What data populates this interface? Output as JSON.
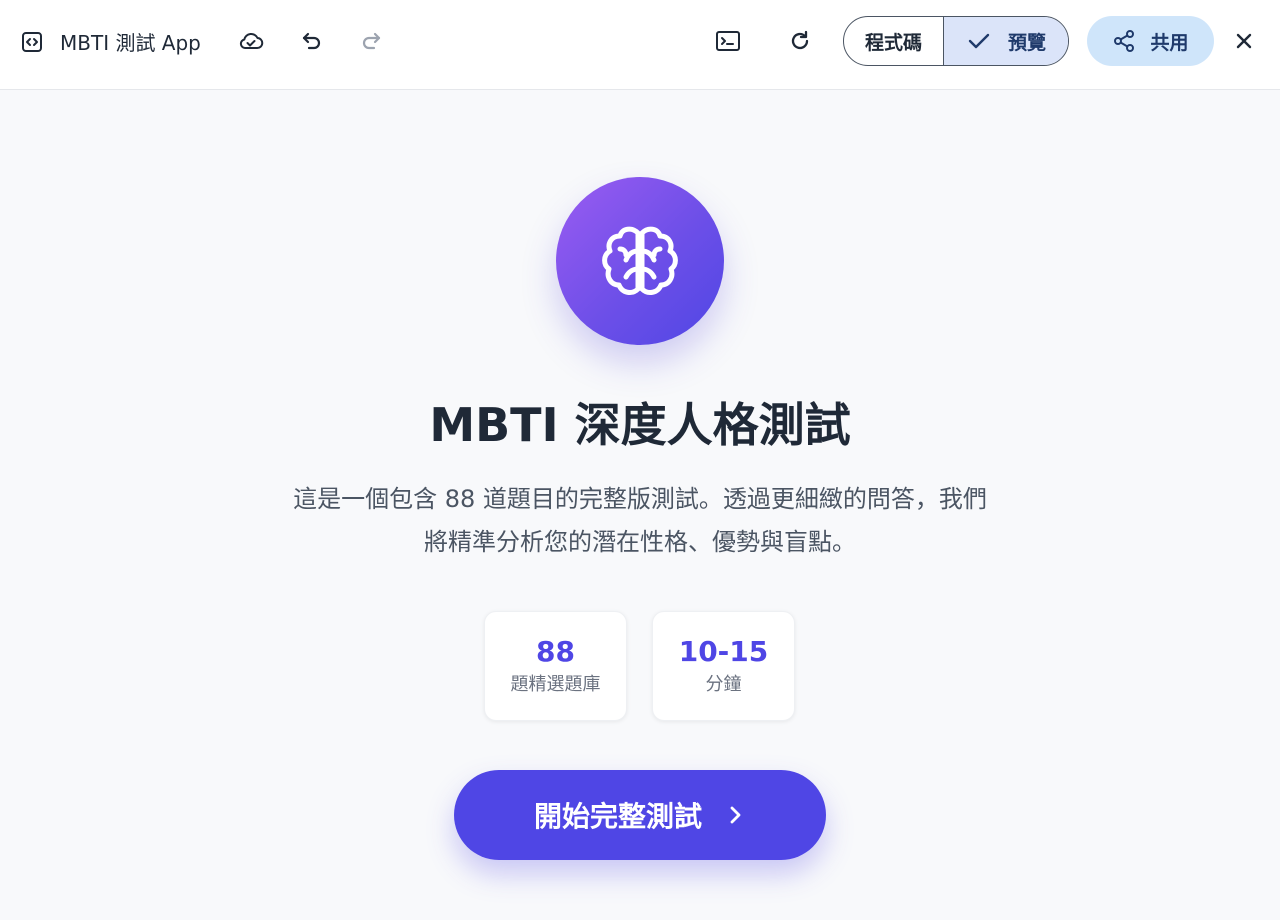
{
  "header": {
    "app_title": "MBTI 測試 App",
    "icons": {
      "app": "code-bracket-icon",
      "cloud": "cloud-sync-icon",
      "undo": "undo-icon",
      "redo": "redo-icon",
      "terminal": "terminal-icon",
      "refresh": "refresh-icon",
      "check": "check-icon",
      "share": "share-icon",
      "close": "close-icon"
    },
    "view_toggle": {
      "code_label": "程式碼",
      "preview_label": "預覽",
      "selected": "預覽"
    },
    "share_label": "共用"
  },
  "main": {
    "hero_icon": "brain-icon",
    "title": "MBTI 深度人格測試",
    "description": "這是一個包含 88 道題目的完整版測試。透過更細緻的問答，我們將精準分析您的潛在性格、優勢與盲點。",
    "stats": [
      {
        "value": "88",
        "label": "題精選題庫"
      },
      {
        "value": "10-15",
        "label": "分鐘"
      }
    ],
    "start_button_label": "開始完整測試",
    "start_button_icon": "chevron-right-icon"
  },
  "colors": {
    "accent": "#4f46e5",
    "gradient_start": "#9b5cf2",
    "gradient_end": "#4f46e5",
    "preview_selected_bg": "#dbe4f9",
    "share_bg": "#cfe5fa",
    "page_bg": "#f8f9fb"
  }
}
